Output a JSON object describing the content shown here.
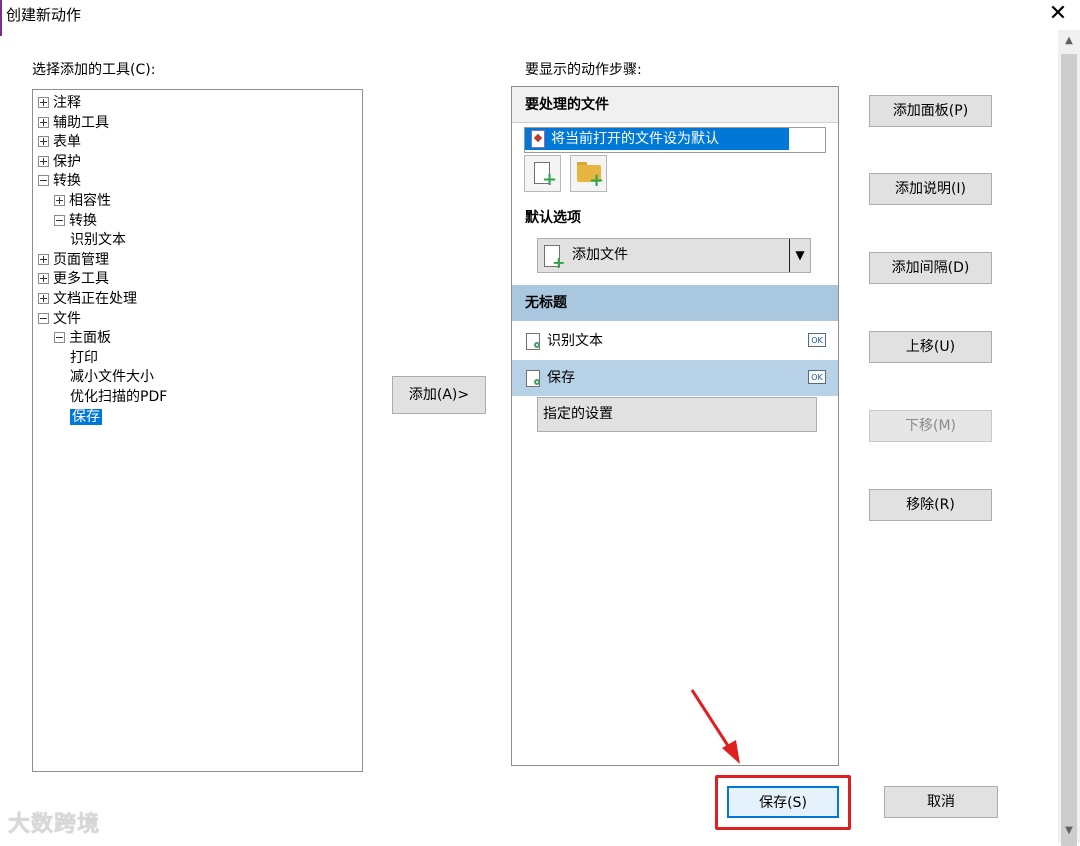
{
  "window": {
    "title": "创建新动作",
    "close_icon": "✕"
  },
  "left": {
    "label": "选择添加的工具(C):",
    "tree": [
      {
        "label": "注释",
        "indent": 0,
        "toggle": "plus"
      },
      {
        "label": "辅助工具",
        "indent": 0,
        "toggle": "plus"
      },
      {
        "label": "表单",
        "indent": 0,
        "toggle": "plus"
      },
      {
        "label": "保护",
        "indent": 0,
        "toggle": "plus"
      },
      {
        "label": "转换",
        "indent": 0,
        "toggle": "minus"
      },
      {
        "label": "相容性",
        "indent": 1,
        "toggle": "plus"
      },
      {
        "label": "转换",
        "indent": 1,
        "toggle": "minus"
      },
      {
        "label": "识别文本",
        "indent": 2,
        "toggle": "none"
      },
      {
        "label": "页面管理",
        "indent": 0,
        "toggle": "plus"
      },
      {
        "label": "更多工具",
        "indent": 0,
        "toggle": "plus"
      },
      {
        "label": "文档正在处理",
        "indent": 0,
        "toggle": "plus"
      },
      {
        "label": "文件",
        "indent": 0,
        "toggle": "minus"
      },
      {
        "label": "主面板",
        "indent": 1,
        "toggle": "minus"
      },
      {
        "label": "打印",
        "indent": 2,
        "toggle": "none"
      },
      {
        "label": "减小文件大小",
        "indent": 2,
        "toggle": "none"
      },
      {
        "label": "优化扫描的PDF",
        "indent": 2,
        "toggle": "none"
      },
      {
        "label": "保存",
        "indent": 2,
        "toggle": "none",
        "selected": true
      }
    ]
  },
  "middle": {
    "add_button": "添加(A)>"
  },
  "right": {
    "label": "要显示的动作步骤:",
    "files_section": "要处理的文件",
    "file_item": "将当前打开的文件设为默认",
    "defaults_label": "默认选项",
    "add_file_dropdown": "添加文件",
    "untitled_section": "无标题",
    "steps": [
      {
        "label": "识别文本",
        "selected": false
      },
      {
        "label": "保存",
        "selected": true
      }
    ],
    "settings_button": "指定的设置"
  },
  "side_buttons": {
    "add_panel": "添加面板(P)",
    "add_note": "添加说明(I)",
    "add_gap": "添加间隔(D)",
    "move_up": "上移(U)",
    "move_down": "下移(M)",
    "remove": "移除(R)"
  },
  "footer": {
    "save": "保存(S)",
    "cancel": "取消"
  },
  "ok_badge": "OK",
  "watermark": "大数跨境",
  "colors": {
    "selection": "#0078d7",
    "section_blue": "#a9c8e0",
    "highlight_red": "#e02020"
  }
}
